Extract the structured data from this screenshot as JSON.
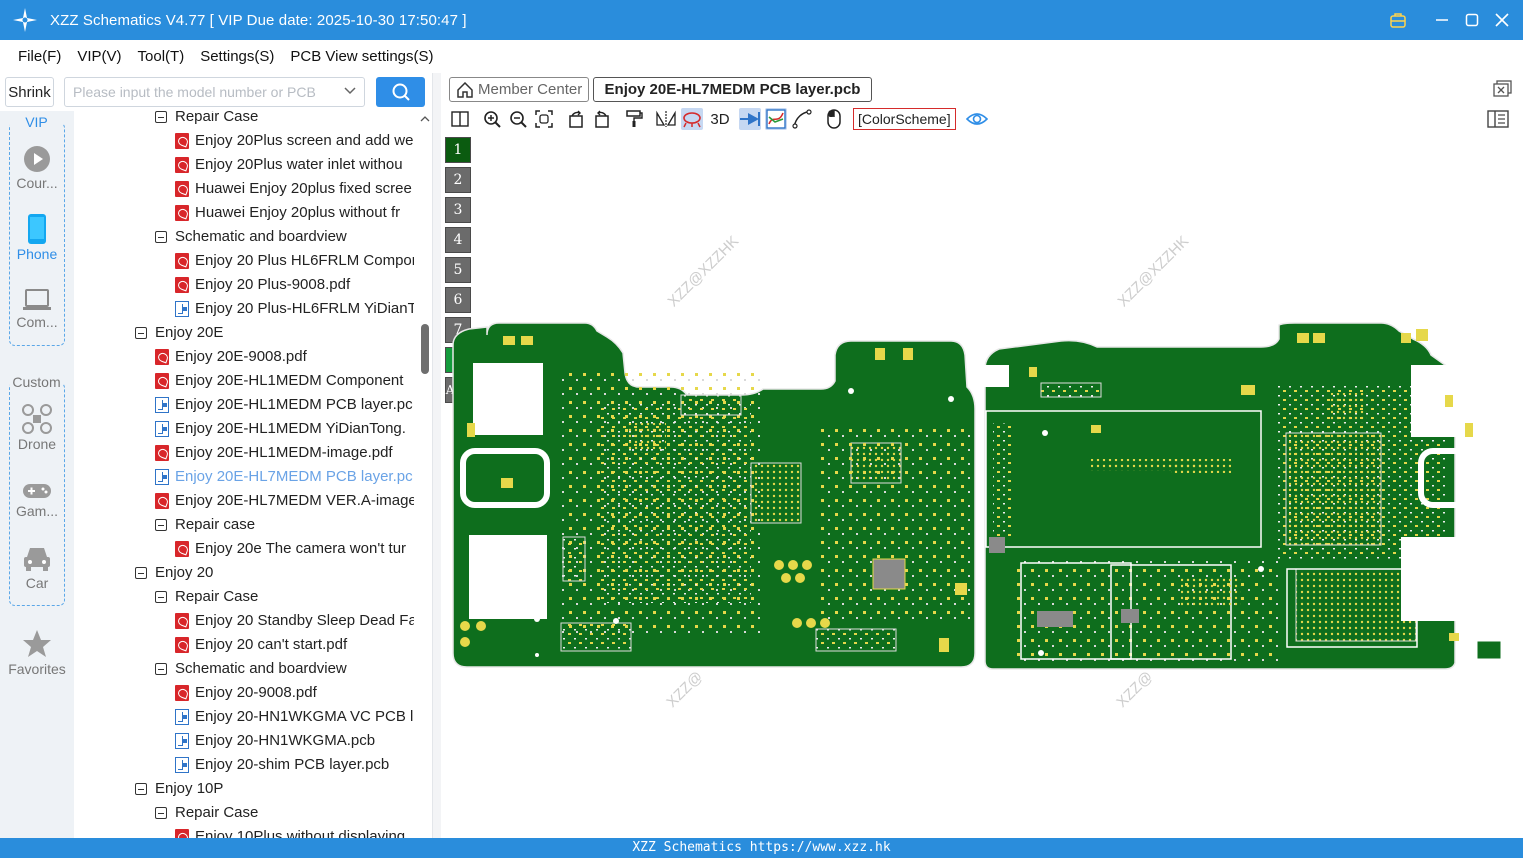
{
  "window": {
    "title": "XZZ Schematics V4.77 [ VIP Due date: 2025-10-30 17:50:47 ]"
  },
  "menu": [
    "File(F)",
    "VIP(V)",
    "Tool(T)",
    "Settings(S)",
    "PCB View settings(S)"
  ],
  "search": {
    "shrink_label": "Shrink",
    "placeholder": "Please input the model number or PCB"
  },
  "leftnav": {
    "vip_title": "VIP",
    "custom_title": "Custom",
    "items": [
      "Cour...",
      "Phone",
      "Com...",
      "Drone",
      "Gam...",
      "Car",
      "Favorites"
    ]
  },
  "tree": [
    {
      "level": 2,
      "kind": "folder",
      "label": "Repair Case"
    },
    {
      "level": 3,
      "kind": "pdf",
      "label": "Enjoy 20Plus screen and add we"
    },
    {
      "level": 3,
      "kind": "pdf",
      "label": "Enjoy 20Plus water inlet withou"
    },
    {
      "level": 3,
      "kind": "pdf",
      "label": "Huawei Enjoy 20plus fixed scree"
    },
    {
      "level": 3,
      "kind": "pdf",
      "label": "Huawei Enjoy 20plus without fr"
    },
    {
      "level": 2,
      "kind": "folder",
      "label": "Schematic and boardview"
    },
    {
      "level": 3,
      "kind": "pdf",
      "label": "Enjoy 20 Plus HL6FRLM Compor"
    },
    {
      "level": 3,
      "kind": "pdf",
      "label": "Enjoy 20 Plus-9008.pdf"
    },
    {
      "level": 3,
      "kind": "pcb",
      "label": "Enjoy 20 Plus-HL6FRLM YiDianT"
    },
    {
      "level": 1,
      "kind": "folder",
      "label": "Enjoy 20E"
    },
    {
      "level": 2,
      "kind": "pdf",
      "label": "Enjoy 20E-9008.pdf"
    },
    {
      "level": 2,
      "kind": "pdf",
      "label": "Enjoy 20E-HL1MEDM Component"
    },
    {
      "level": 2,
      "kind": "pcb",
      "label": "Enjoy 20E-HL1MEDM PCB layer.pc"
    },
    {
      "level": 2,
      "kind": "pcb",
      "label": "Enjoy 20E-HL1MEDM YiDianTong."
    },
    {
      "level": 2,
      "kind": "pdf",
      "label": "Enjoy 20E-HL1MEDM-image.pdf"
    },
    {
      "level": 2,
      "kind": "pcb",
      "label": "Enjoy 20E-HL7MEDM PCB layer.pc",
      "selected": true
    },
    {
      "level": 2,
      "kind": "pdf",
      "label": "Enjoy 20E-HL7MEDM VER.A-image"
    },
    {
      "level": 2,
      "kind": "folder",
      "label": "Repair case"
    },
    {
      "level": 3,
      "kind": "pdf",
      "label": "Enjoy 20e The camera won't tur"
    },
    {
      "level": 1,
      "kind": "folder",
      "label": "Enjoy 20"
    },
    {
      "level": 2,
      "kind": "folder",
      "label": "Repair Case"
    },
    {
      "level": 3,
      "kind": "pdf",
      "label": "Enjoy 20 Standby Sleep Dead Fa"
    },
    {
      "level": 3,
      "kind": "pdf",
      "label": "Enjoy 20 can't start.pdf"
    },
    {
      "level": 2,
      "kind": "folder",
      "label": "Schematic and boardview"
    },
    {
      "level": 3,
      "kind": "pdf",
      "label": "Enjoy 20-9008.pdf"
    },
    {
      "level": 3,
      "kind": "pcb",
      "label": "Enjoy 20-HN1WKGMA VC PCB l"
    },
    {
      "level": 3,
      "kind": "pcb",
      "label": "Enjoy 20-HN1WKGMA.pcb"
    },
    {
      "level": 3,
      "kind": "pcb",
      "label": "Enjoy 20-shim PCB layer.pcb"
    },
    {
      "level": 1,
      "kind": "folder",
      "label": "Enjoy 10P"
    },
    {
      "level": 2,
      "kind": "folder",
      "label": "Repair Case"
    },
    {
      "level": 3,
      "kind": "pdf",
      "label": "Enjoy 10Plus without displaying"
    }
  ],
  "tabs": {
    "member_center": "Member Center",
    "active": "Enjoy 20E-HL7MEDM PCB layer.pcb"
  },
  "toolbar": {
    "three_d": "3D",
    "color_scheme": "[ColorScheme]"
  },
  "layers": [
    "1",
    "2",
    "3",
    "4",
    "5",
    "6",
    "7",
    "8",
    "ALL"
  ],
  "watermarks": [
    "XZZ@XZZHK",
    "XZZ@XZZHK",
    "XZZ@",
    "XZZ@"
  ],
  "status": "XZZ Schematics https://www.xzz.hk",
  "colors": {
    "accent": "#2a8ddc",
    "pcb_green": "#0e6e1d",
    "pad_yellow": "#e6d84a"
  }
}
